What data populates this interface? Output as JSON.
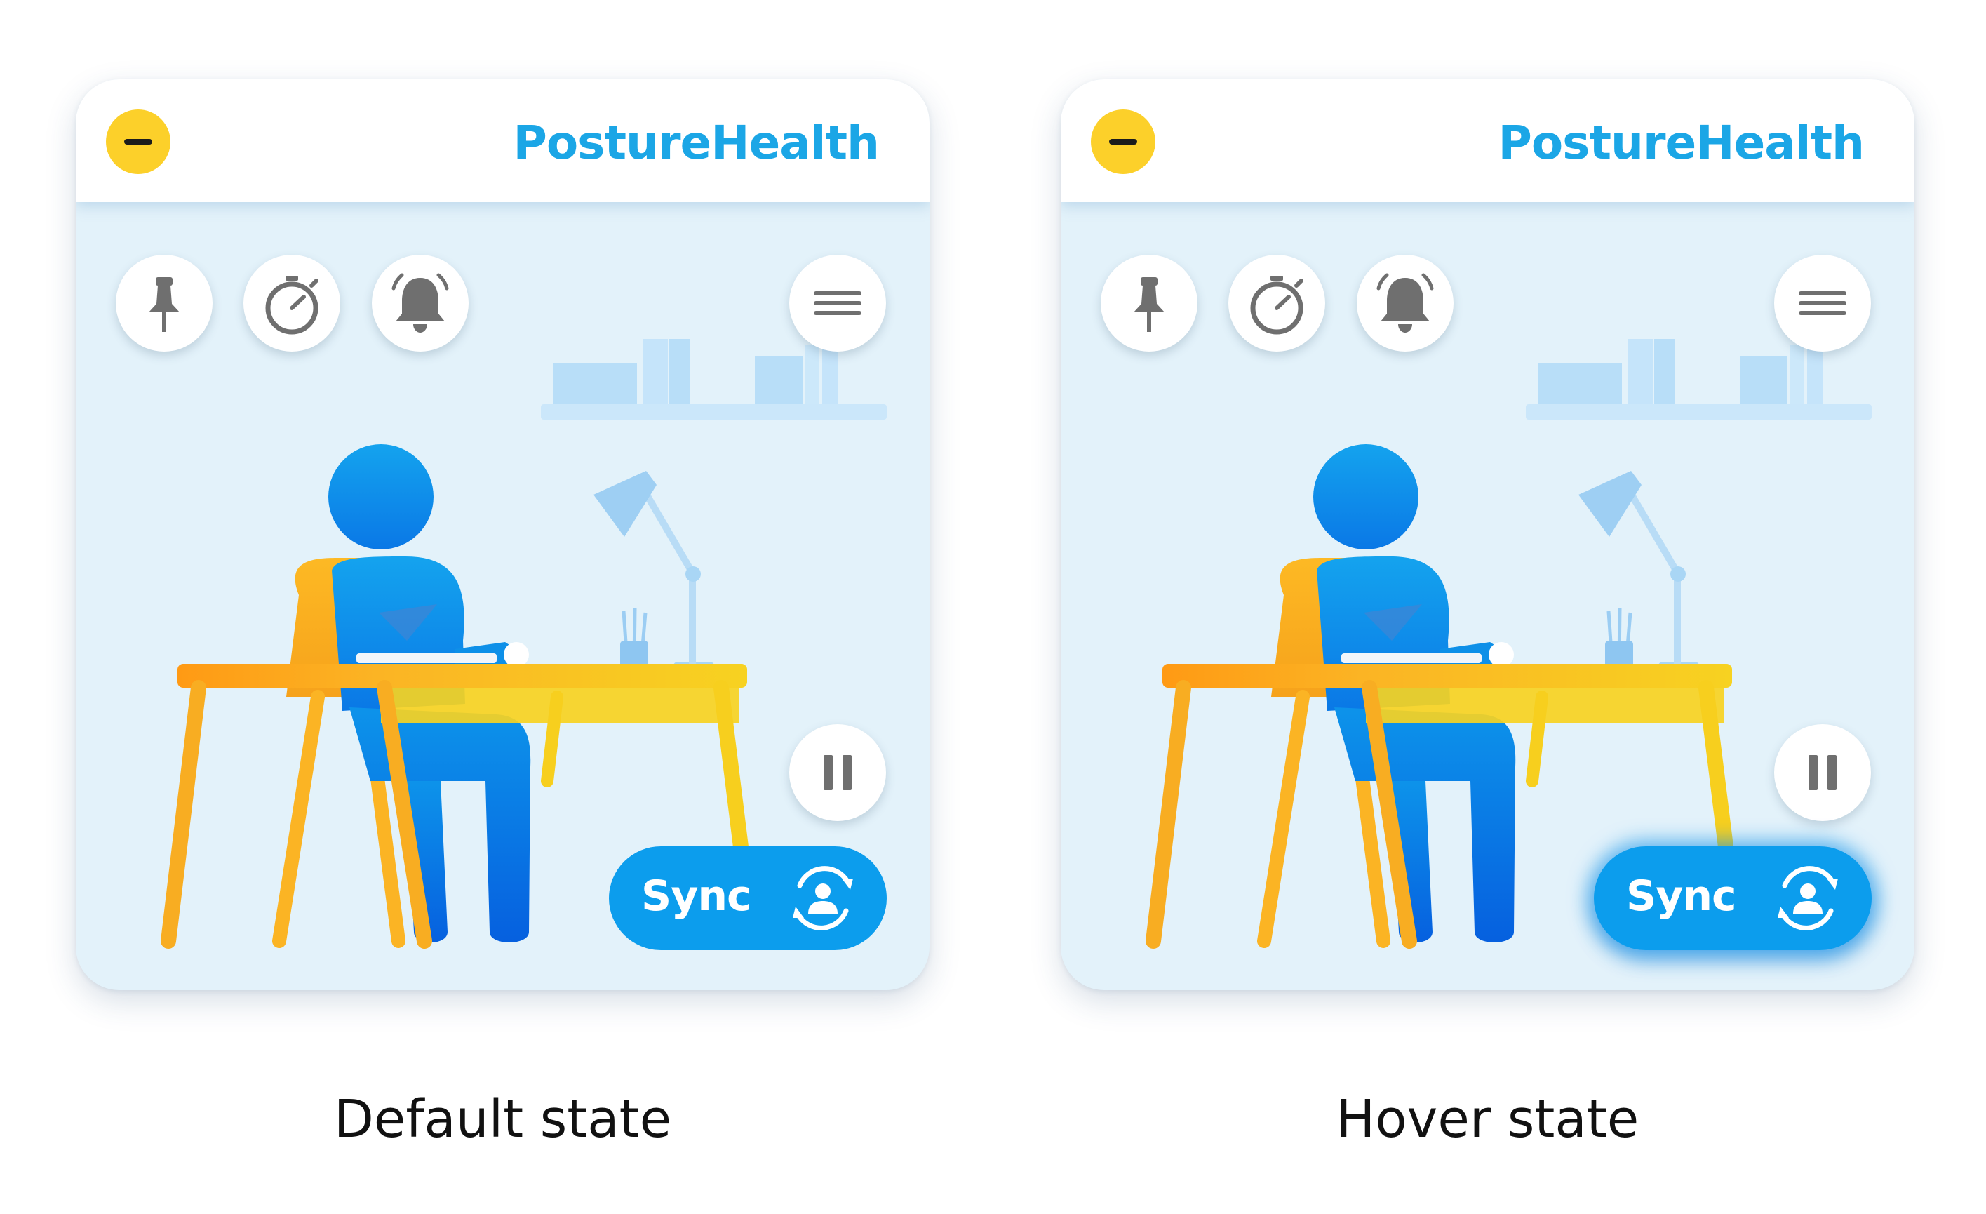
{
  "panels": [
    {
      "state": "default",
      "brand": "PostureHealth",
      "sync_label": "Sync",
      "caption": "Default state"
    },
    {
      "state": "hover",
      "brand": "PostureHealth",
      "sync_label": "Sync",
      "caption": "Hover state"
    }
  ],
  "icons": {
    "minimize": "minus-icon",
    "pin": "pin-icon",
    "timer": "stopwatch-icon",
    "alert": "bell-icon",
    "menu": "hamburger-menu-icon",
    "pause": "pause-icon",
    "sync": "sync-user-icon"
  },
  "colors": {
    "brand": "#1ba6e6",
    "accent_blue": "#0c9ded",
    "minimize_yellow": "#fcd02a",
    "widget_bg": "#e3f2fa",
    "icon_gray": "#6f6f6f"
  }
}
